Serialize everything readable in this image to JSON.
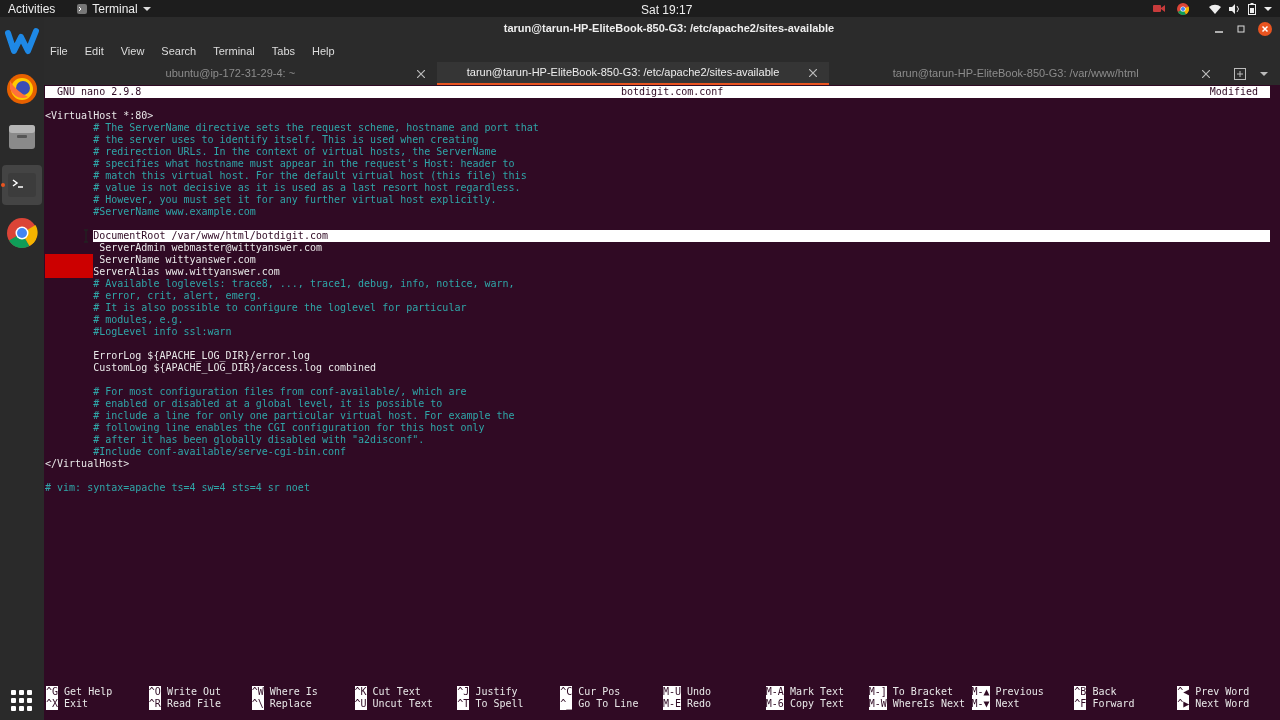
{
  "top_bar": {
    "activities": "Activities",
    "app_menu": "Terminal",
    "clock": "Sat 19:17"
  },
  "dock": [
    {
      "kind": "w",
      "selected": false
    },
    {
      "kind": "firefox",
      "selected": false
    },
    {
      "kind": "files",
      "selected": false
    },
    {
      "kind": "terminal",
      "selected": true
    },
    {
      "kind": "chrome",
      "selected": false
    }
  ],
  "window": {
    "title": "tarun@tarun-HP-EliteBook-850-G3: /etc/apache2/sites-available",
    "menu": [
      "File",
      "Edit",
      "View",
      "Search",
      "Terminal",
      "Tabs",
      "Help"
    ],
    "tabs": [
      {
        "label": "ubuntu@ip-172-31-29-4: ~",
        "selected": false
      },
      {
        "label": "tarun@tarun-HP-EliteBook-850-G3: /etc/apache2/sites-available",
        "selected": true
      },
      {
        "label": "tarun@tarun-HP-EliteBook-850-G3: /var/www/html",
        "selected": false
      }
    ]
  },
  "nano": {
    "version": "GNU nano 2.9.8",
    "filename": "botdigit.com.conf",
    "status": "Modified",
    "lines": [
      {
        "text": "<VirtualHost *:80>",
        "kind": "code",
        "current": false,
        "bad_whitespace": false
      },
      {
        "text": "        # The ServerName directive sets the request scheme, hostname and port that",
        "kind": "comment",
        "current": false,
        "bad_whitespace": false
      },
      {
        "text": "        # the server uses to identify itself. This is used when creating",
        "kind": "comment",
        "current": false,
        "bad_whitespace": false
      },
      {
        "text": "        # redirection URLs. In the context of virtual hosts, the ServerName",
        "kind": "comment",
        "current": false,
        "bad_whitespace": false
      },
      {
        "text": "        # specifies what hostname must appear in the request's Host: header to",
        "kind": "comment",
        "current": false,
        "bad_whitespace": false
      },
      {
        "text": "        # match this virtual host. For the default virtual host (this file) this",
        "kind": "comment",
        "current": false,
        "bad_whitespace": false
      },
      {
        "text": "        # value is not decisive as it is used as a last resort host regardless.",
        "kind": "comment",
        "current": false,
        "bad_whitespace": false
      },
      {
        "text": "        # However, you must set it for any further virtual host explicitly.",
        "kind": "comment",
        "current": false,
        "bad_whitespace": false
      },
      {
        "text": "        #ServerName www.example.com",
        "kind": "comment",
        "current": false,
        "bad_whitespace": false
      },
      {
        "kind": "blank"
      },
      {
        "text": "        DocumentRoot /var/www/html/botdigit.com",
        "kind": "code",
        "current": true,
        "bad_whitespace": false
      },
      {
        "text": "         ServerAdmin webmaster@wittyanswer.com",
        "kind": "code",
        "current": false,
        "bad_whitespace": false
      },
      {
        "text": "         ServerName wittyanswer.com",
        "kind": "code",
        "current": false,
        "bad_whitespace": true
      },
      {
        "text": "        ServerAlias www.wittyanswer.com",
        "kind": "code",
        "current": false,
        "bad_whitespace": true
      },
      {
        "text": "        # Available loglevels: trace8, ..., trace1, debug, info, notice, warn,",
        "kind": "comment",
        "current": false,
        "bad_whitespace": false
      },
      {
        "text": "        # error, crit, alert, emerg.",
        "kind": "comment",
        "current": false,
        "bad_whitespace": false
      },
      {
        "text": "        # It is also possible to configure the loglevel for particular",
        "kind": "comment",
        "current": false,
        "bad_whitespace": false
      },
      {
        "text": "        # modules, e.g.",
        "kind": "comment",
        "current": false,
        "bad_whitespace": false
      },
      {
        "text": "        #LogLevel info ssl:warn",
        "kind": "comment",
        "current": false,
        "bad_whitespace": false
      },
      {
        "kind": "blank"
      },
      {
        "text": "        ErrorLog ${APACHE_LOG_DIR}/error.log",
        "kind": "code",
        "current": false,
        "bad_whitespace": false
      },
      {
        "text": "        CustomLog ${APACHE_LOG_DIR}/access.log combined",
        "kind": "code",
        "current": false,
        "bad_whitespace": false
      },
      {
        "kind": "blank"
      },
      {
        "text": "        # For most configuration files from conf-available/, which are",
        "kind": "comment",
        "current": false,
        "bad_whitespace": false
      },
      {
        "text": "        # enabled or disabled at a global level, it is possible to",
        "kind": "comment",
        "current": false,
        "bad_whitespace": false
      },
      {
        "text": "        # include a line for only one particular virtual host. For example the",
        "kind": "comment",
        "current": false,
        "bad_whitespace": false
      },
      {
        "text": "        # following line enables the CGI configuration for this host only",
        "kind": "comment",
        "current": false,
        "bad_whitespace": false
      },
      {
        "text": "        # after it has been globally disabled with \"a2disconf\".",
        "kind": "comment",
        "current": false,
        "bad_whitespace": false
      },
      {
        "text": "        #Include conf-available/serve-cgi-bin.conf",
        "kind": "comment",
        "current": false,
        "bad_whitespace": false
      },
      {
        "text": "</VirtualHost>",
        "kind": "code",
        "current": false,
        "bad_whitespace": false
      },
      {
        "kind": "blank"
      },
      {
        "text": "# vim: syntax=apache ts=4 sw=4 sts=4 sr noet",
        "kind": "comment",
        "current": false,
        "bad_whitespace": false
      }
    ],
    "shortcuts": [
      [
        {
          "key": "^G",
          "label": "Get Help"
        },
        {
          "key": "^X",
          "label": "Exit"
        }
      ],
      [
        {
          "key": "^O",
          "label": "Write Out"
        },
        {
          "key": "^R",
          "label": "Read File"
        }
      ],
      [
        {
          "key": "^W",
          "label": "Where Is"
        },
        {
          "key": "^\\",
          "label": "Replace"
        }
      ],
      [
        {
          "key": "^K",
          "label": "Cut Text"
        },
        {
          "key": "^U",
          "label": "Uncut Text"
        }
      ],
      [
        {
          "key": "^J",
          "label": "Justify"
        },
        {
          "key": "^T",
          "label": "To Spell"
        }
      ],
      [
        {
          "key": "^C",
          "label": "Cur Pos"
        },
        {
          "key": "^_",
          "label": "Go To Line"
        }
      ],
      [
        {
          "key": "M-U",
          "label": "Undo"
        },
        {
          "key": "M-E",
          "label": "Redo"
        }
      ],
      [
        {
          "key": "M-A",
          "label": "Mark Text"
        },
        {
          "key": "M-6",
          "label": "Copy Text"
        }
      ],
      [
        {
          "key": "M-]",
          "label": "To Bracket"
        },
        {
          "key": "M-W",
          "label": "WhereIs Next"
        }
      ],
      [
        {
          "key": "M-▲",
          "label": "Previous"
        },
        {
          "key": "M-▼",
          "label": "Next"
        }
      ],
      [
        {
          "key": "^B",
          "label": "Back"
        },
        {
          "key": "^F",
          "label": "Forward"
        }
      ],
      [
        {
          "key": "^◀",
          "label": "Prev Word"
        },
        {
          "key": "^▶",
          "label": "Next Word"
        }
      ]
    ]
  }
}
